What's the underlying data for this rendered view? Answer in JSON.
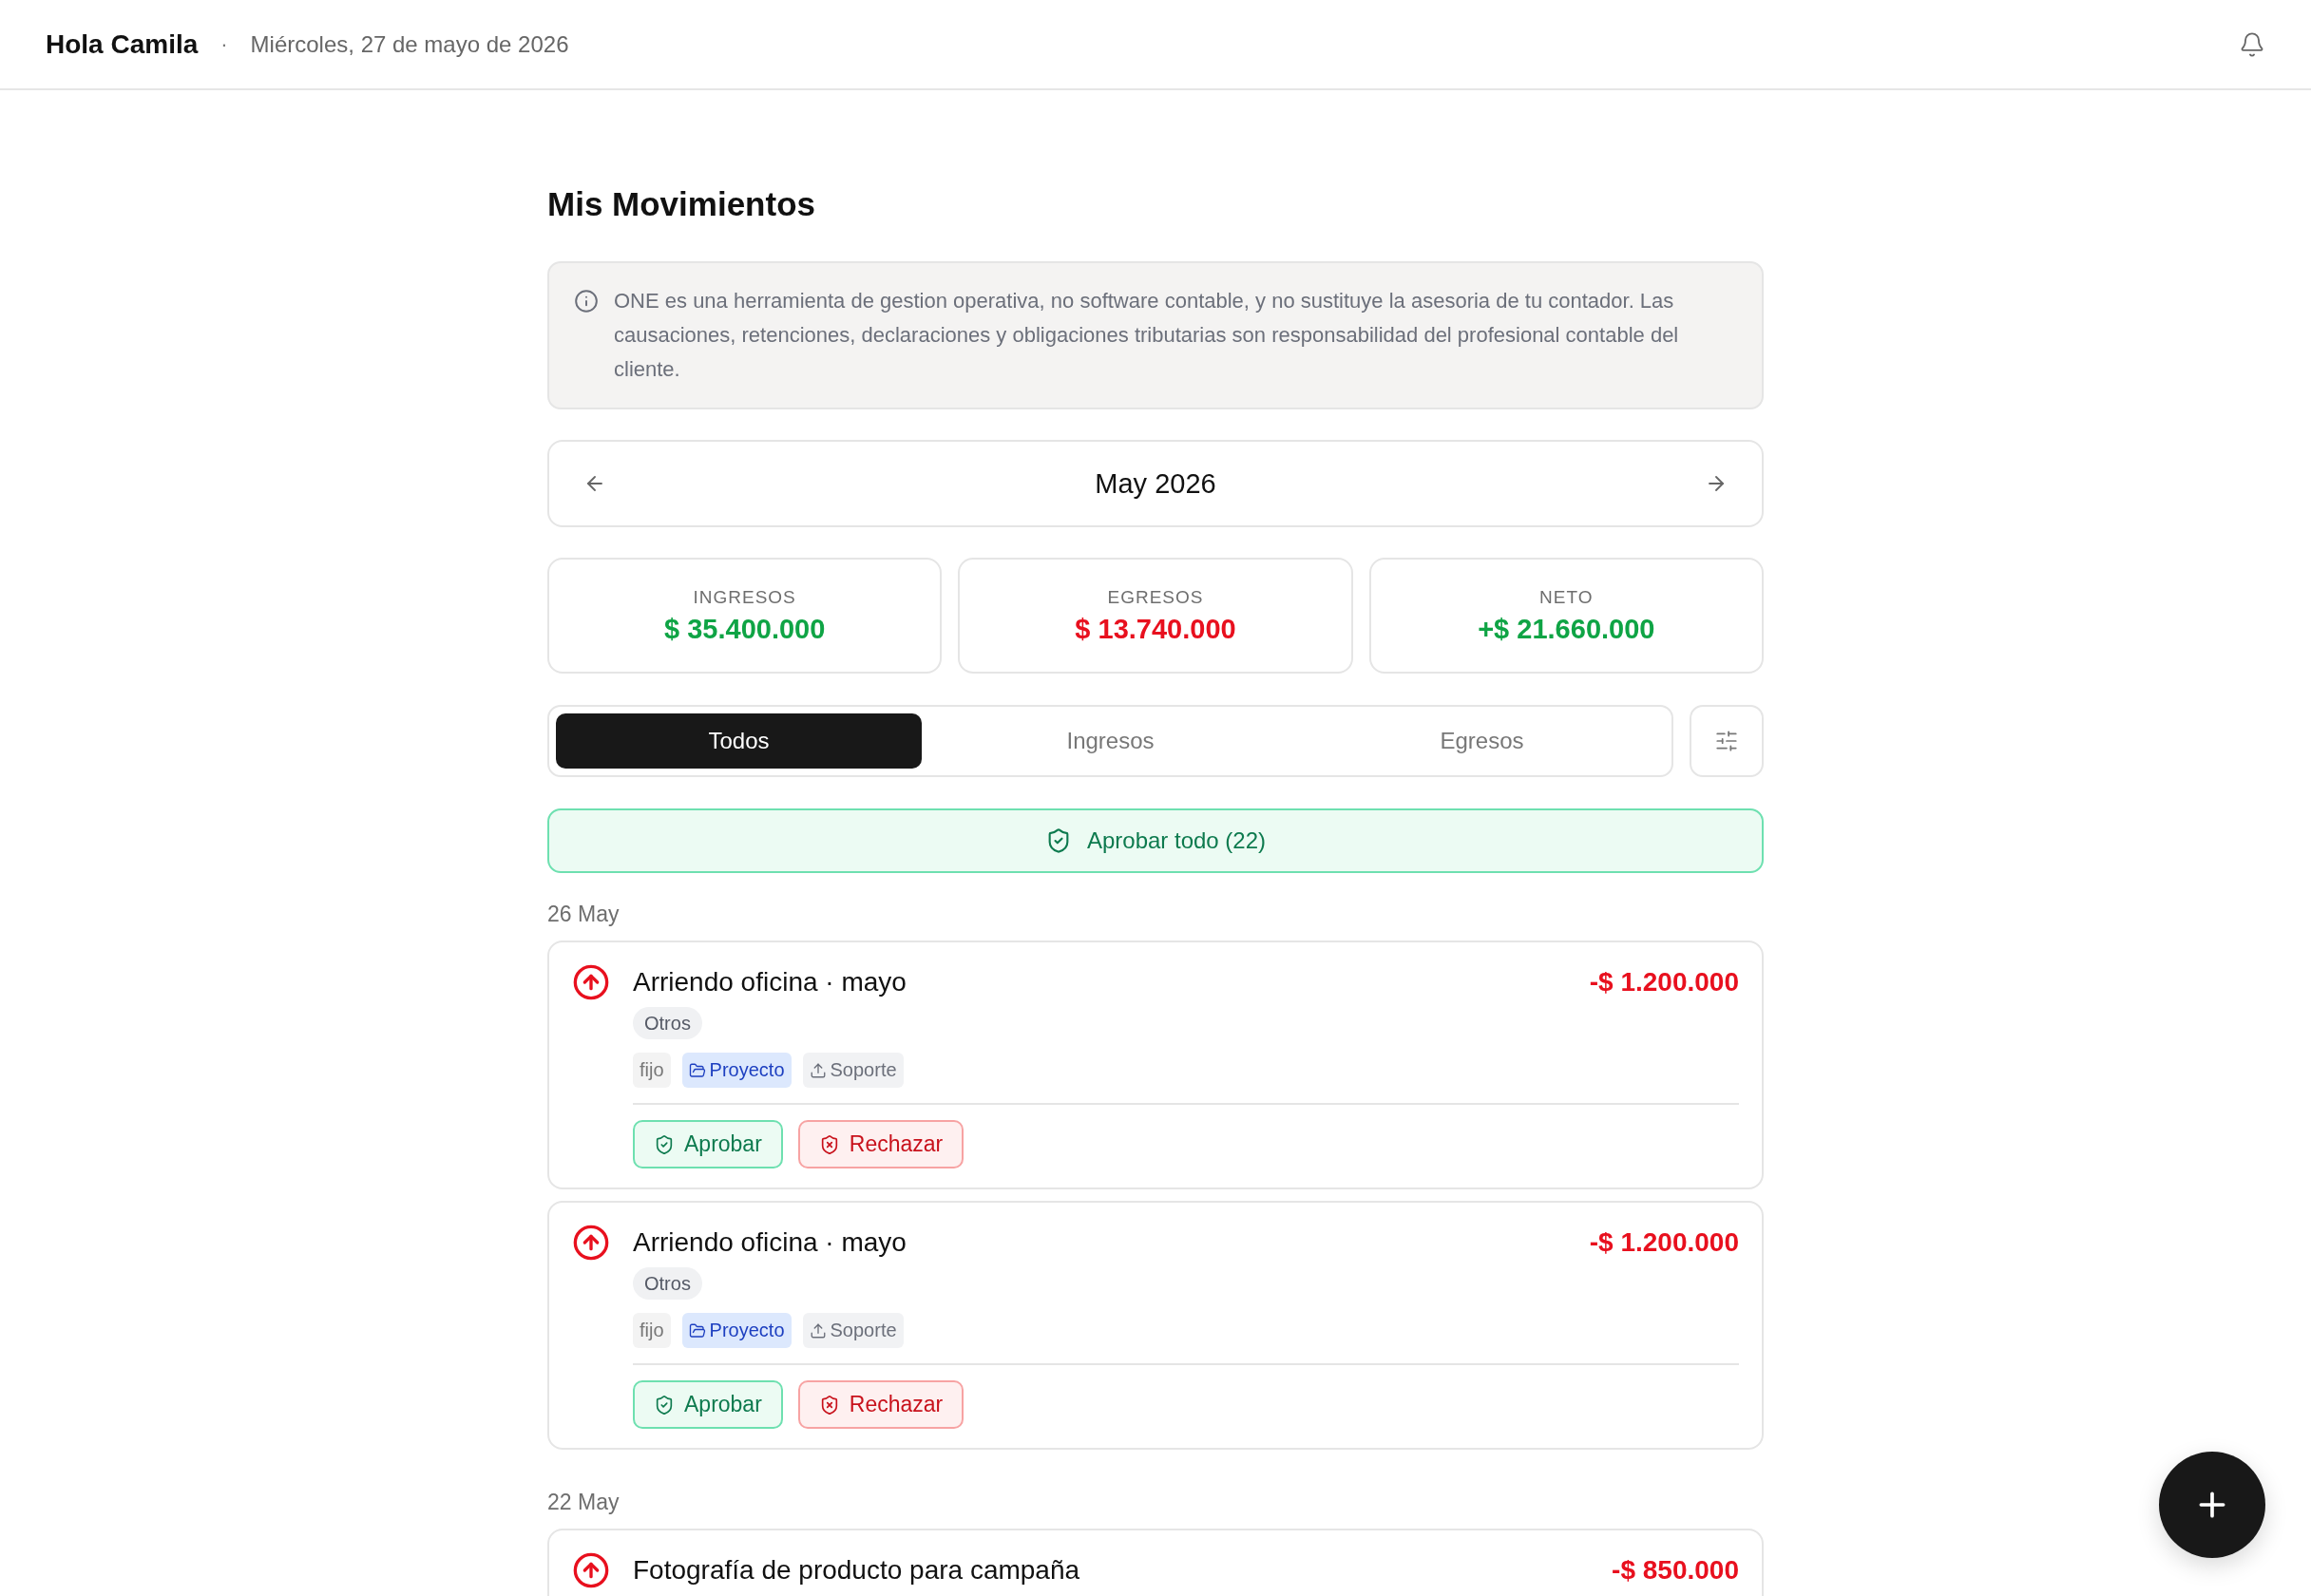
{
  "header": {
    "greeting": "Hola Camila",
    "separator": "·",
    "date": "Miércoles, 27 de mayo de 2026"
  },
  "page_title": "Mis Movimientos",
  "notice": "ONE es una herramienta de gestion operativa, no software contable, y no sustituye la asesoria de tu contador. Las causaciones, retenciones, declaraciones y obligaciones tributarias son responsabilidad del profesional contable del cliente.",
  "month": "May 2026",
  "summary": [
    {
      "kind": "income",
      "label": "INGRESOS",
      "amount": "$ 35.400.000"
    },
    {
      "kind": "expense",
      "label": "EGRESOS",
      "amount": "$ 13.740.000"
    },
    {
      "kind": "income",
      "label": "NETO",
      "amount": "+$ 21.660.000"
    }
  ],
  "tabs": [
    {
      "label": "Todos",
      "selected": true
    },
    {
      "label": "Ingresos",
      "selected": false
    },
    {
      "label": "Egresos",
      "selected": false
    }
  ],
  "approve_all": "Aprobar todo (22)",
  "groups": [
    {
      "date": "26 May",
      "items": [
        {
          "kind": "expense",
          "title": "Arriendo oficina · mayo",
          "amount": "-$ 1.200.000",
          "category": "Otros",
          "tags": [
            {
              "kind": "plain",
              "label": "fijo"
            },
            {
              "kind": "project",
              "label": "Proyecto"
            },
            {
              "kind": "upload",
              "label": "Soporte"
            }
          ],
          "actions": [
            {
              "kind": "approve",
              "label": "Aprobar"
            },
            {
              "kind": "reject",
              "label": "Rechazar"
            }
          ]
        },
        {
          "kind": "expense",
          "title": "Arriendo oficina · mayo",
          "amount": "-$ 1.200.000",
          "category": "Otros",
          "tags": [
            {
              "kind": "plain",
              "label": "fijo"
            },
            {
              "kind": "project",
              "label": "Proyecto"
            },
            {
              "kind": "upload",
              "label": "Soporte"
            }
          ],
          "actions": [
            {
              "kind": "approve",
              "label": "Aprobar"
            },
            {
              "kind": "reject",
              "label": "Rechazar"
            }
          ]
        }
      ]
    },
    {
      "date": "22 May",
      "items": [
        {
          "kind": "expense",
          "title": "Fotografía de producto para campaña",
          "amount": "-$ 850.000"
        }
      ]
    }
  ]
}
